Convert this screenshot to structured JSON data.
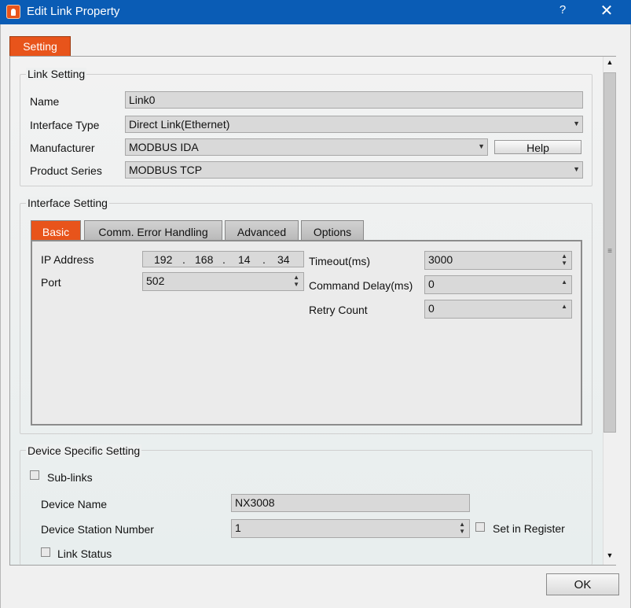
{
  "window": {
    "title": "Edit Link Property",
    "help_glyph": "?",
    "close_glyph": "✕"
  },
  "tabs_top": {
    "setting": "Setting"
  },
  "link_setting": {
    "title": "Link Setting",
    "name_label": "Name",
    "name_value": "Link0",
    "interface_type_label": "Interface Type",
    "interface_type_value": "Direct Link(Ethernet)",
    "manufacturer_label": "Manufacturer",
    "manufacturer_value": "MODBUS IDA",
    "help_label": "Help",
    "product_series_label": "Product Series",
    "product_series_value": "MODBUS TCP"
  },
  "interface_setting": {
    "title": "Interface Setting",
    "tabs": [
      "Basic",
      "Comm. Error Handling",
      "Advanced",
      "Options"
    ],
    "ip_label": "IP Address",
    "ip_octets": [
      "192",
      "168",
      "14",
      "34"
    ],
    "ip_dot": ".",
    "port_label": "Port",
    "port_value": "502",
    "timeout_label": "Timeout(ms)",
    "timeout_value": "3000",
    "command_delay_label": "Command Delay(ms)",
    "command_delay_value": "0",
    "retry_label": "Retry Count",
    "retry_value": "0"
  },
  "device_setting": {
    "title": "Device Specific Setting",
    "sublinks_label": "Sub-links",
    "device_name_label": "Device Name",
    "device_name_value": "NX3008",
    "station_label": "Device Station Number",
    "station_value": "1",
    "set_in_register_label": "Set in Register",
    "link_status_label": "Link Status"
  },
  "footer": {
    "ok_label": "OK"
  },
  "colors": {
    "accent": "#e8541b",
    "titlebar": "#0a5cb5"
  }
}
